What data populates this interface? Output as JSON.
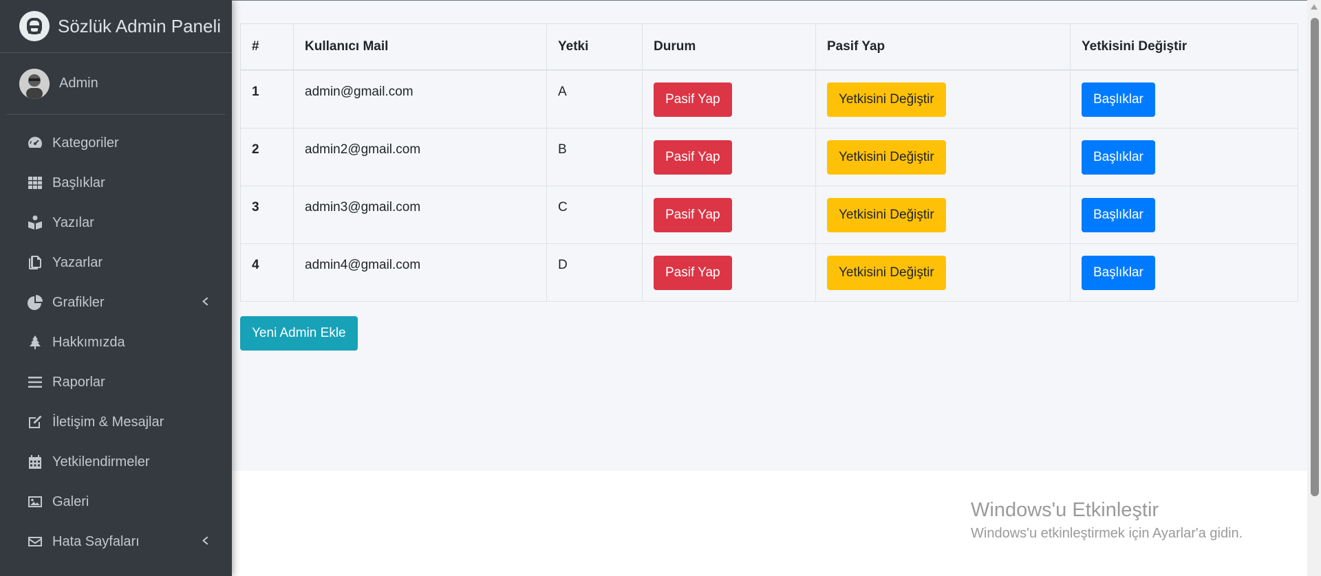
{
  "sidebar": {
    "brand": "Sözlük Admin Paneli",
    "user": "Admin",
    "items": [
      {
        "label": "Kategoriler",
        "icon": "tachometer-icon"
      },
      {
        "label": "Başlıklar",
        "icon": "grid-icon"
      },
      {
        "label": "Yazılar",
        "icon": "reader-icon"
      },
      {
        "label": "Yazarlar",
        "icon": "copy-icon"
      },
      {
        "label": "Grafikler",
        "icon": "pie-chart-icon",
        "chevron": true
      },
      {
        "label": "Hakkımızda",
        "icon": "tree-icon"
      },
      {
        "label": "Raporlar",
        "icon": "bars-icon"
      },
      {
        "label": "İletişim & Mesajlar",
        "icon": "edit-icon"
      },
      {
        "label": "Yetkilendirmeler",
        "icon": "calendar-icon"
      },
      {
        "label": "Galeri",
        "icon": "image-icon"
      },
      {
        "label": "Hata Sayfaları",
        "icon": "envelope-icon",
        "chevron": true
      }
    ]
  },
  "table": {
    "headers": [
      "#",
      "Kullanıcı Mail",
      "Yetki",
      "Durum",
      "Pasif Yap",
      "Yetkisini Değiştir"
    ],
    "rows": [
      {
        "num": "1",
        "mail": "admin@gmail.com",
        "role": "A"
      },
      {
        "num": "2",
        "mail": "admin2@gmail.com",
        "role": "B"
      },
      {
        "num": "3",
        "mail": "admin3@gmail.com",
        "role": "C"
      },
      {
        "num": "4",
        "mail": "admin4@gmail.com",
        "role": "D"
      }
    ],
    "buttons": {
      "passive": "Pasif Yap",
      "change_role": "Yetkisini Değiştir",
      "titles": "Başlıklar"
    }
  },
  "add_button": "Yeni Admin Ekle",
  "watermark": {
    "title": "Windows'u Etkinleştir",
    "subtitle": "Windows'u etkinleştirmek için Ayarlar'a gidin."
  },
  "colors": {
    "sidebar_bg": "#343a40",
    "danger": "#dc3545",
    "warning": "#ffc107",
    "primary": "#007bff",
    "info": "#17a2b8"
  }
}
